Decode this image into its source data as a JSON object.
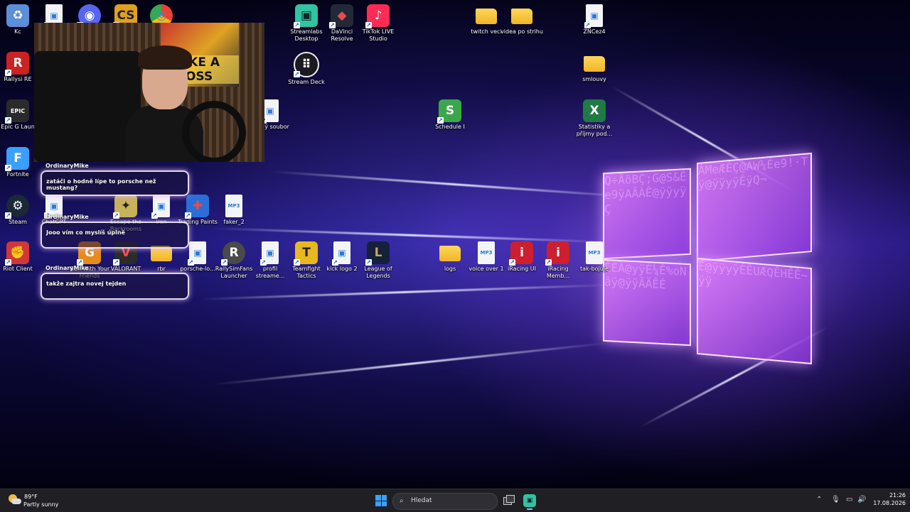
{
  "desktop_icons": [
    {
      "label": "Kc",
      "glyph": "♻",
      "color": "#5b8fd8"
    },
    {
      "label": "",
      "glyph": "▣",
      "color": "#e8eef8"
    },
    {
      "label": "",
      "glyph": "◉",
      "color": "#5865f2"
    },
    {
      "label": "",
      "glyph": "CS",
      "color": "#e0a020"
    },
    {
      "label": "",
      "glyph": "◎",
      "color": "#ffffff"
    },
    {
      "label": "Streamlabs Desktop",
      "glyph": "▣",
      "color": "#31c3a2"
    },
    {
      "label": "DaVinci Resolve",
      "glyph": "◆",
      "color": "#222a38"
    },
    {
      "label": "TikTok LIVE Studio",
      "glyph": "♪",
      "color": "#fe2c55"
    },
    {
      "label": "twitch veci",
      "glyph": "",
      "color": "#f0b42a"
    },
    {
      "label": "videa po strihu",
      "glyph": "",
      "color": "#f0b42a"
    },
    {
      "label": "ZNCez4",
      "glyph": "▣",
      "color": "#e8eef8"
    },
    {
      "label": "Stream Deck",
      "glyph": "⠿",
      "color": "#1b1b1f"
    },
    {
      "label": "smlouvy",
      "glyph": "",
      "color": "#f0b42a"
    },
    {
      "label": "Rallysi RE",
      "glyph": "R",
      "color": "#cc2222"
    },
    {
      "label": "ažený soubor",
      "glyph": "▣",
      "color": "#e8eef8"
    },
    {
      "label": "Schedule I",
      "glyph": "S",
      "color": "#3aa84a"
    },
    {
      "label": "Statistiky a příjmy pod...",
      "glyph": "X",
      "color": "#1f7a44"
    },
    {
      "label": "Epic G Laun",
      "glyph": "EPIC",
      "color": "#2a2a2a"
    },
    {
      "label": "Fortnite",
      "glyph": "F",
      "color": "#3aa0ff"
    },
    {
      "label": "ChatGPT",
      "glyph": "▣",
      "color": "#e8eef8"
    },
    {
      "label": "Escape the Backrooms",
      "glyph": "✦",
      "color": "#c7b15a"
    },
    {
      "label": "iron",
      "glyph": "▣",
      "color": "#e8eef8"
    },
    {
      "label": "Trading Paints",
      "glyph": "✚",
      "color": "#e84b4b"
    },
    {
      "label": "faker_2",
      "glyph": "MP3",
      "color": "#e8eef8"
    },
    {
      "label": "Steam",
      "glyph": "⚙",
      "color": "#1b2838"
    },
    {
      "label": "Golf With Your Friends",
      "glyph": "G",
      "color": "#e88a1a"
    },
    {
      "label": "VALORANT",
      "glyph": "V",
      "color": "#2b2b2b"
    },
    {
      "label": "rbr",
      "glyph": "",
      "color": "#f0b42a"
    },
    {
      "label": "porsche-lo...",
      "glyph": "▣",
      "color": "#e8eef8"
    },
    {
      "label": "RallySimFans Launcher",
      "glyph": "R",
      "color": "#4a4a4a"
    },
    {
      "label": "profil streame...",
      "glyph": "▣",
      "color": "#e8eef8"
    },
    {
      "label": "Teamfight Tactics",
      "glyph": "T",
      "color": "#e8b820"
    },
    {
      "label": "kick logo 2",
      "glyph": "▣",
      "color": "#e8eef8"
    },
    {
      "label": "League of Legends",
      "glyph": "L",
      "color": "#c8a85a"
    },
    {
      "label": "logs",
      "glyph": "",
      "color": "#f0b42a"
    },
    {
      "label": "voice over 1",
      "glyph": "MP3",
      "color": "#e8eef8"
    },
    {
      "label": "iRacing UI",
      "glyph": "i",
      "color": "#cc1f2f"
    },
    {
      "label": "iRacing Memb...",
      "glyph": "i",
      "color": "#cc1f2f"
    },
    {
      "label": "tak-bojuje",
      "glyph": "MP3",
      "color": "#e8eef8"
    },
    {
      "label": "Riot Client",
      "glyph": "✊",
      "color": "#d13639"
    }
  ],
  "webcam": {
    "poster_text": "LIKE A BOSS"
  },
  "chat": [
    {
      "user": "OrdinaryMike",
      "message": "zatáči o hodně lípe to porsche než mustang?"
    },
    {
      "user": "OrdinaryMike",
      "message": "Jooo vím co myslíš úplně"
    },
    {
      "user": "OrdinaryMike",
      "message": "takže zajtra novej tejden"
    }
  ],
  "taskbar": {
    "weather_temp": "89°F",
    "weather_desc": "Partly sunny",
    "search_placeholder": "Hledat",
    "time": "21:26",
    "date": "17.08.2026",
    "tray_chevron": "⌃",
    "tray_mic": "🎙",
    "tray_display": "▭",
    "tray_volume": "🔊",
    "search_glyph": "⌕",
    "streamlabs_glyph": "▣"
  },
  "colors": {
    "taskbar_bg": "#1f1f24",
    "start_blue": "#3aa0ff",
    "glow_purple": "#c878ff"
  }
}
